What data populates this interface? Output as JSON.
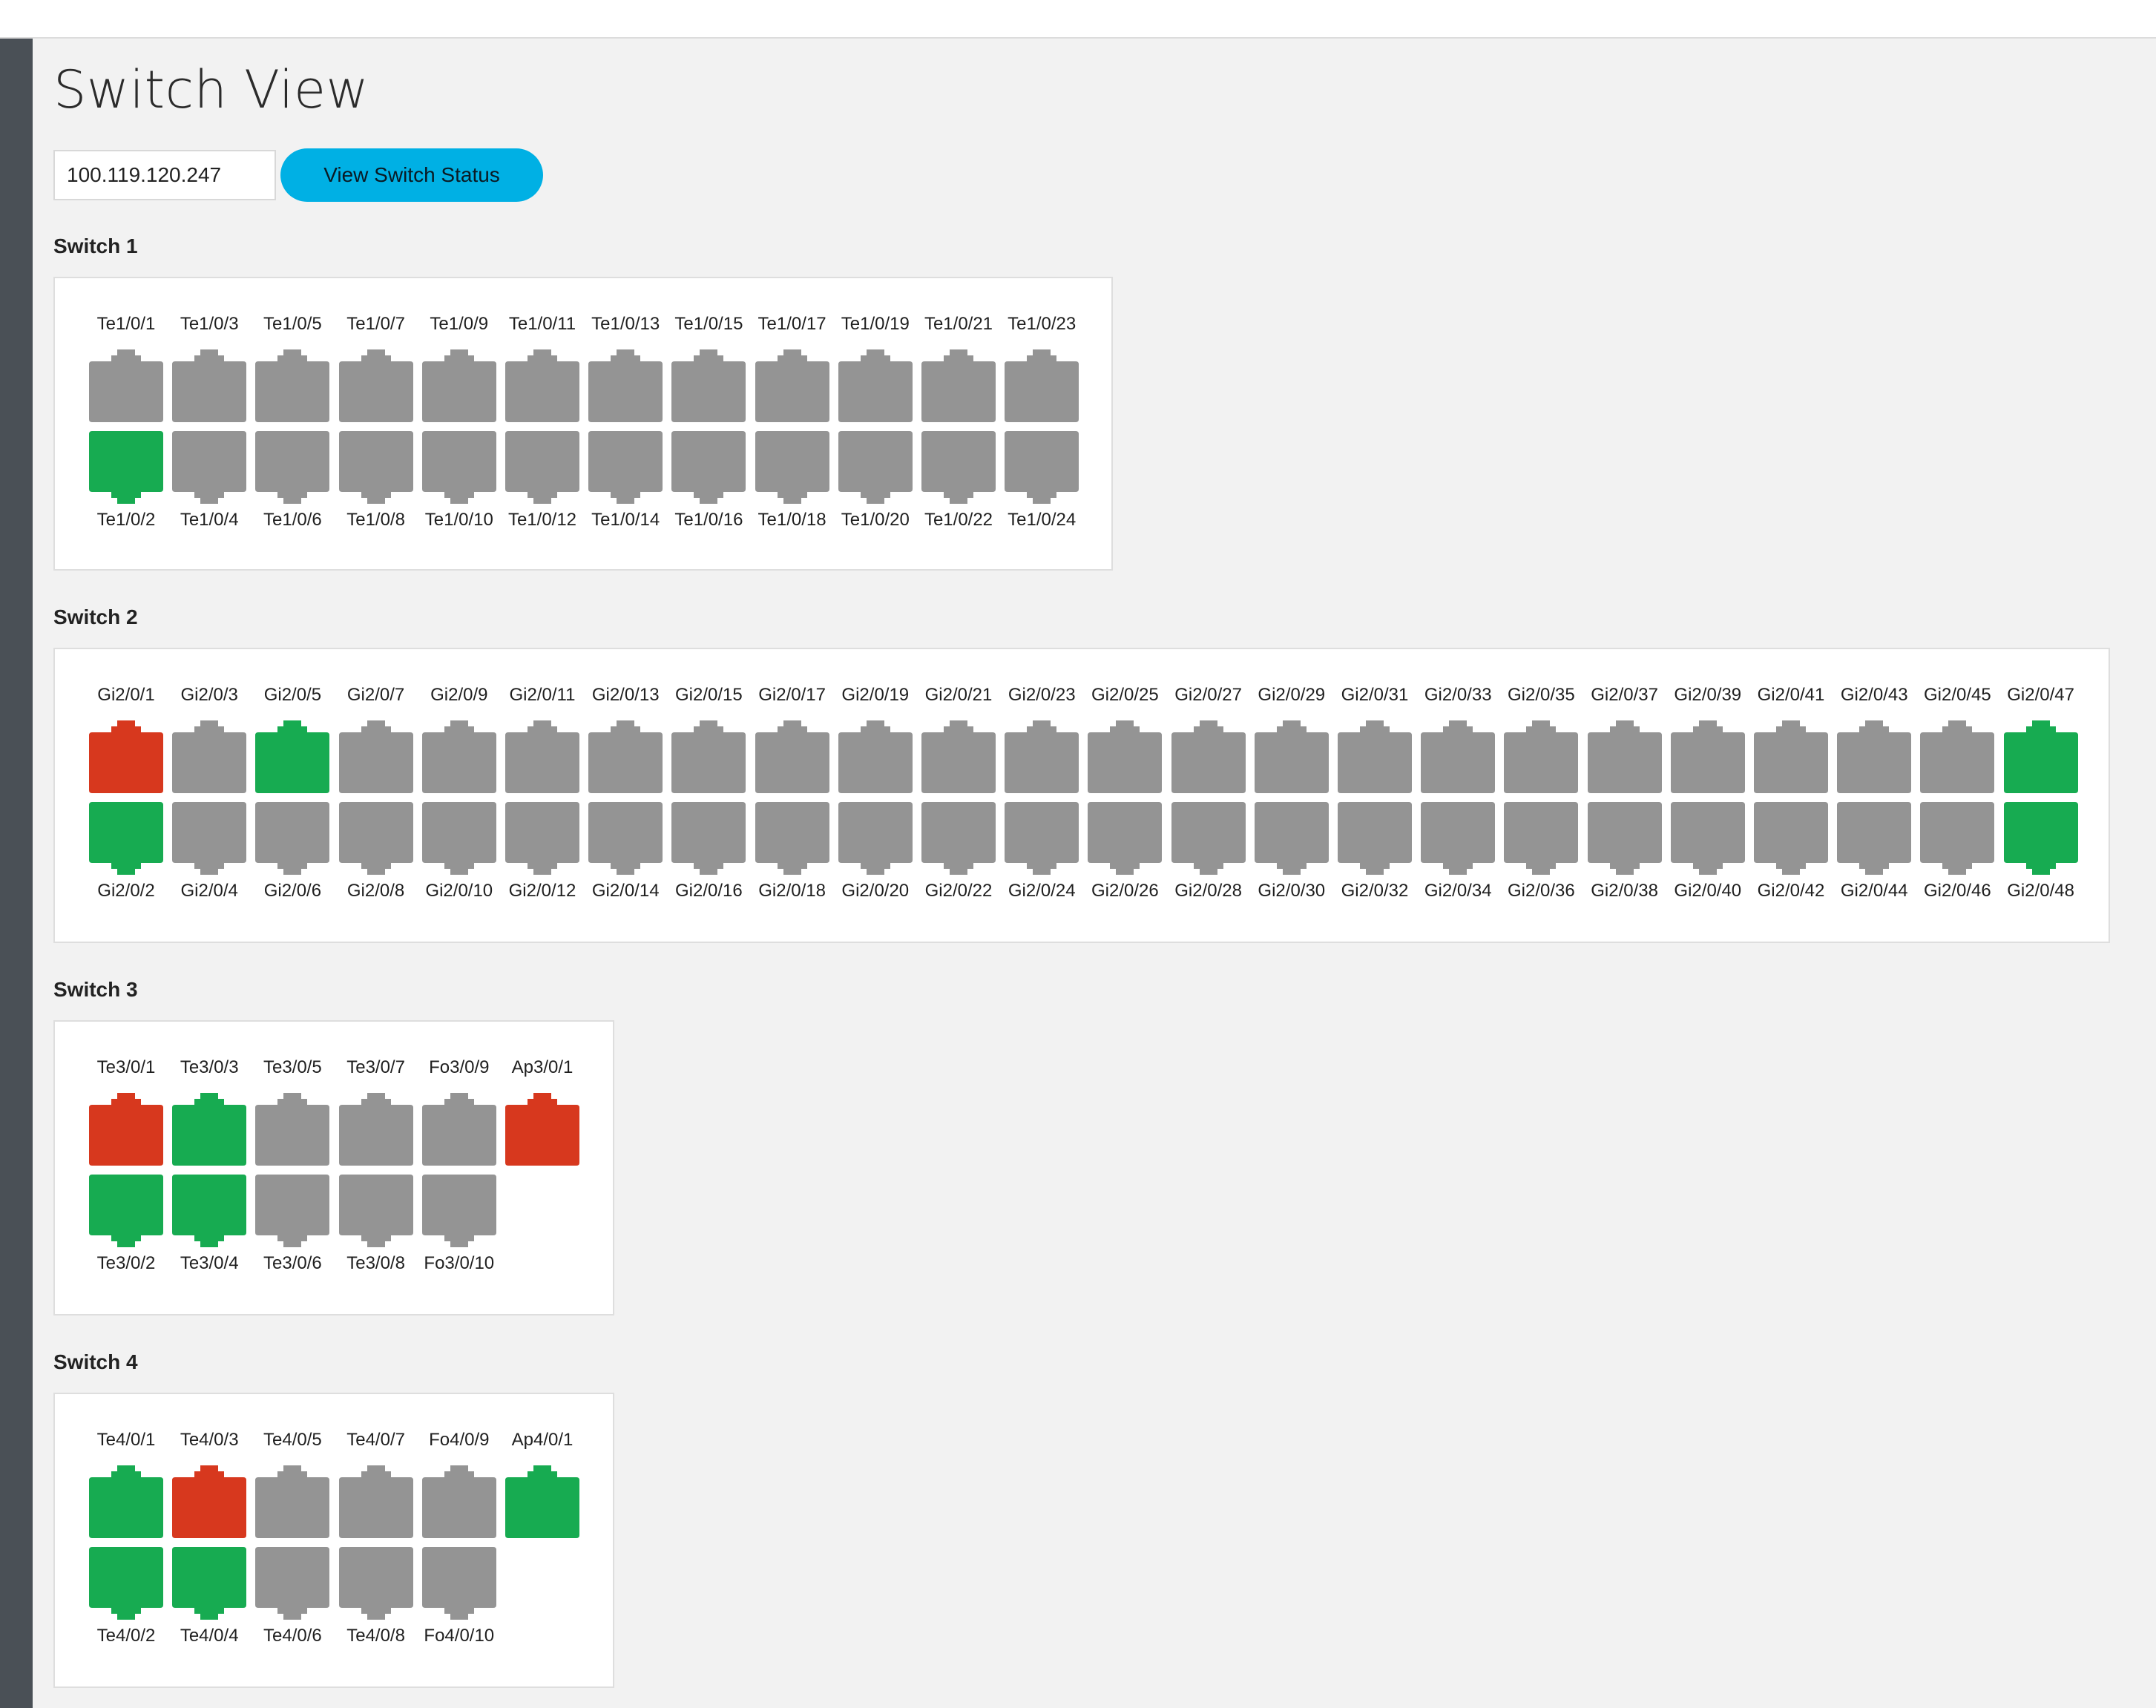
{
  "page": {
    "title": "Switch View"
  },
  "search": {
    "ip_value": "100.119.120.247",
    "button_label": "View Switch Status"
  },
  "colors": {
    "gray": "#949494",
    "green": "#17ab51",
    "red": "#d7381e",
    "accent": "#00b0e4"
  },
  "switches": [
    {
      "title": "Switch 1",
      "top_ports": [
        {
          "label": "Te1/0/1",
          "status": "gray"
        },
        {
          "label": "Te1/0/3",
          "status": "gray"
        },
        {
          "label": "Te1/0/5",
          "status": "gray"
        },
        {
          "label": "Te1/0/7",
          "status": "gray"
        },
        {
          "label": "Te1/0/9",
          "status": "gray"
        },
        {
          "label": "Te1/0/11",
          "status": "gray"
        },
        {
          "label": "Te1/0/13",
          "status": "gray"
        },
        {
          "label": "Te1/0/15",
          "status": "gray"
        },
        {
          "label": "Te1/0/17",
          "status": "gray"
        },
        {
          "label": "Te1/0/19",
          "status": "gray"
        },
        {
          "label": "Te1/0/21",
          "status": "gray"
        },
        {
          "label": "Te1/0/23",
          "status": "gray"
        }
      ],
      "bottom_ports": [
        {
          "label": "Te1/0/2",
          "status": "green"
        },
        {
          "label": "Te1/0/4",
          "status": "gray"
        },
        {
          "label": "Te1/0/6",
          "status": "gray"
        },
        {
          "label": "Te1/0/8",
          "status": "gray"
        },
        {
          "label": "Te1/0/10",
          "status": "gray"
        },
        {
          "label": "Te1/0/12",
          "status": "gray"
        },
        {
          "label": "Te1/0/14",
          "status": "gray"
        },
        {
          "label": "Te1/0/16",
          "status": "gray"
        },
        {
          "label": "Te1/0/18",
          "status": "gray"
        },
        {
          "label": "Te1/0/20",
          "status": "gray"
        },
        {
          "label": "Te1/0/22",
          "status": "gray"
        },
        {
          "label": "Te1/0/24",
          "status": "gray"
        }
      ]
    },
    {
      "title": "Switch 2",
      "top_ports": [
        {
          "label": "Gi2/0/1",
          "status": "red"
        },
        {
          "label": "Gi2/0/3",
          "status": "gray"
        },
        {
          "label": "Gi2/0/5",
          "status": "green"
        },
        {
          "label": "Gi2/0/7",
          "status": "gray"
        },
        {
          "label": "Gi2/0/9",
          "status": "gray"
        },
        {
          "label": "Gi2/0/11",
          "status": "gray"
        },
        {
          "label": "Gi2/0/13",
          "status": "gray"
        },
        {
          "label": "Gi2/0/15",
          "status": "gray"
        },
        {
          "label": "Gi2/0/17",
          "status": "gray"
        },
        {
          "label": "Gi2/0/19",
          "status": "gray"
        },
        {
          "label": "Gi2/0/21",
          "status": "gray"
        },
        {
          "label": "Gi2/0/23",
          "status": "gray"
        },
        {
          "label": "Gi2/0/25",
          "status": "gray"
        },
        {
          "label": "Gi2/0/27",
          "status": "gray"
        },
        {
          "label": "Gi2/0/29",
          "status": "gray"
        },
        {
          "label": "Gi2/0/31",
          "status": "gray"
        },
        {
          "label": "Gi2/0/33",
          "status": "gray"
        },
        {
          "label": "Gi2/0/35",
          "status": "gray"
        },
        {
          "label": "Gi2/0/37",
          "status": "gray"
        },
        {
          "label": "Gi2/0/39",
          "status": "gray"
        },
        {
          "label": "Gi2/0/41",
          "status": "gray"
        },
        {
          "label": "Gi2/0/43",
          "status": "gray"
        },
        {
          "label": "Gi2/0/45",
          "status": "gray"
        },
        {
          "label": "Gi2/0/47",
          "status": "green"
        }
      ],
      "bottom_ports": [
        {
          "label": "Gi2/0/2",
          "status": "green"
        },
        {
          "label": "Gi2/0/4",
          "status": "gray"
        },
        {
          "label": "Gi2/0/6",
          "status": "gray"
        },
        {
          "label": "Gi2/0/8",
          "status": "gray"
        },
        {
          "label": "Gi2/0/10",
          "status": "gray"
        },
        {
          "label": "Gi2/0/12",
          "status": "gray"
        },
        {
          "label": "Gi2/0/14",
          "status": "gray"
        },
        {
          "label": "Gi2/0/16",
          "status": "gray"
        },
        {
          "label": "Gi2/0/18",
          "status": "gray"
        },
        {
          "label": "Gi2/0/20",
          "status": "gray"
        },
        {
          "label": "Gi2/0/22",
          "status": "gray"
        },
        {
          "label": "Gi2/0/24",
          "status": "gray"
        },
        {
          "label": "Gi2/0/26",
          "status": "gray"
        },
        {
          "label": "Gi2/0/28",
          "status": "gray"
        },
        {
          "label": "Gi2/0/30",
          "status": "gray"
        },
        {
          "label": "Gi2/0/32",
          "status": "gray"
        },
        {
          "label": "Gi2/0/34",
          "status": "gray"
        },
        {
          "label": "Gi2/0/36",
          "status": "gray"
        },
        {
          "label": "Gi2/0/38",
          "status": "gray"
        },
        {
          "label": "Gi2/0/40",
          "status": "gray"
        },
        {
          "label": "Gi2/0/42",
          "status": "gray"
        },
        {
          "label": "Gi2/0/44",
          "status": "gray"
        },
        {
          "label": "Gi2/0/46",
          "status": "gray"
        },
        {
          "label": "Gi2/0/48",
          "status": "green"
        }
      ]
    },
    {
      "title": "Switch 3",
      "top_ports": [
        {
          "label": "Te3/0/1",
          "status": "red"
        },
        {
          "label": "Te3/0/3",
          "status": "green"
        },
        {
          "label": "Te3/0/5",
          "status": "gray"
        },
        {
          "label": "Te3/0/7",
          "status": "gray"
        },
        {
          "label": "Fo3/0/9",
          "status": "gray"
        },
        {
          "label": "Ap3/0/1",
          "status": "red"
        }
      ],
      "bottom_ports": [
        {
          "label": "Te3/0/2",
          "status": "green"
        },
        {
          "label": "Te3/0/4",
          "status": "green"
        },
        {
          "label": "Te3/0/6",
          "status": "gray"
        },
        {
          "label": "Te3/0/8",
          "status": "gray"
        },
        {
          "label": "Fo3/0/10",
          "status": "gray"
        }
      ]
    },
    {
      "title": "Switch 4",
      "top_ports": [
        {
          "label": "Te4/0/1",
          "status": "green"
        },
        {
          "label": "Te4/0/3",
          "status": "red"
        },
        {
          "label": "Te4/0/5",
          "status": "gray"
        },
        {
          "label": "Te4/0/7",
          "status": "gray"
        },
        {
          "label": "Fo4/0/9",
          "status": "gray"
        },
        {
          "label": "Ap4/0/1",
          "status": "green"
        }
      ],
      "bottom_ports": [
        {
          "label": "Te4/0/2",
          "status": "green"
        },
        {
          "label": "Te4/0/4",
          "status": "green"
        },
        {
          "label": "Te4/0/6",
          "status": "gray"
        },
        {
          "label": "Te4/0/8",
          "status": "gray"
        },
        {
          "label": "Fo4/0/10",
          "status": "gray"
        }
      ]
    }
  ]
}
